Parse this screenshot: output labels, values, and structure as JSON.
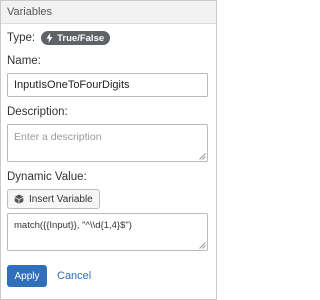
{
  "panel": {
    "title": "Variables"
  },
  "type": {
    "label": "Type:",
    "badge": "True/False",
    "badge_icon": "lightning-icon"
  },
  "name": {
    "label": "Name:",
    "value": "InputIsOneToFourDigits"
  },
  "description": {
    "label": "Description:",
    "placeholder": "Enter a description"
  },
  "dynamic_value": {
    "label": "Dynamic Value:",
    "insert_button": "Insert Variable",
    "insert_icon": "cube-icon",
    "expression": "match({{Input}}, \"^\\\\d{1,4}$\")"
  },
  "actions": {
    "apply": "Apply",
    "cancel": "Cancel"
  },
  "colors": {
    "primary": "#2f6fbb",
    "badge": "#5f6368"
  }
}
